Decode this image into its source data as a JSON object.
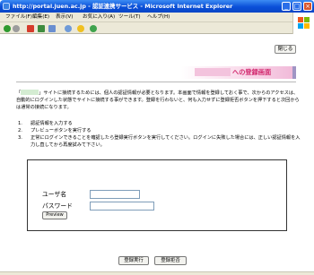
{
  "window": {
    "title": "http://portal.juen.ac.jp - 認証連携サービス - Microsoft Internet Explorer",
    "minimize": "_",
    "maximize": "□",
    "close": "×"
  },
  "menu": {
    "items": [
      "ファイル(F)",
      "編集(E)",
      "表示(V)",
      "お気に入り(A)",
      "ツール(T)",
      "ヘルプ(H)"
    ]
  },
  "toolbar": {
    "icons": [
      "back-icon",
      "forward-icon",
      "stop-icon",
      "refresh-icon",
      "home-icon",
      "search-icon",
      "favorites-icon",
      "history-icon"
    ]
  },
  "page": {
    "close_button": "閉じる",
    "banner_title": "への登録画面",
    "intro_text_before": "「",
    "intro_text_after": "」サイトに接続するためには、個人の認証情報が必要となります。本画面で情報を登録しておく事で、次からのアクセスは、自動的にログインした状態でサイトに接続する事ができます。登録を行わないと、何も入力せずに登録拒否ボタンを押下すると次回からは通常の接続になります。",
    "steps": [
      {
        "num": "1.",
        "text": "認証情報を入力する"
      },
      {
        "num": "2.",
        "text": "プレビューボタンを実行する"
      },
      {
        "num": "3.",
        "text": "正常にログインできることを確認したら登録実行ボタンを実行してください。ログインに失敗した場合には、正しい認証情報を入力し直してから再度試みて下さい。"
      }
    ],
    "form": {
      "username_label": "ユーザ名",
      "password_label": "パスワード",
      "username_value": "",
      "password_value": "",
      "preview_button": "Preview"
    },
    "register_button": "登録実行",
    "refuse_button": "登録拒否"
  },
  "colors": {
    "titlebar": "#0a4fd8",
    "banner_text": "#d2286e",
    "banner_bg": "#f7cfe4",
    "chrome": "#ece9d8"
  }
}
